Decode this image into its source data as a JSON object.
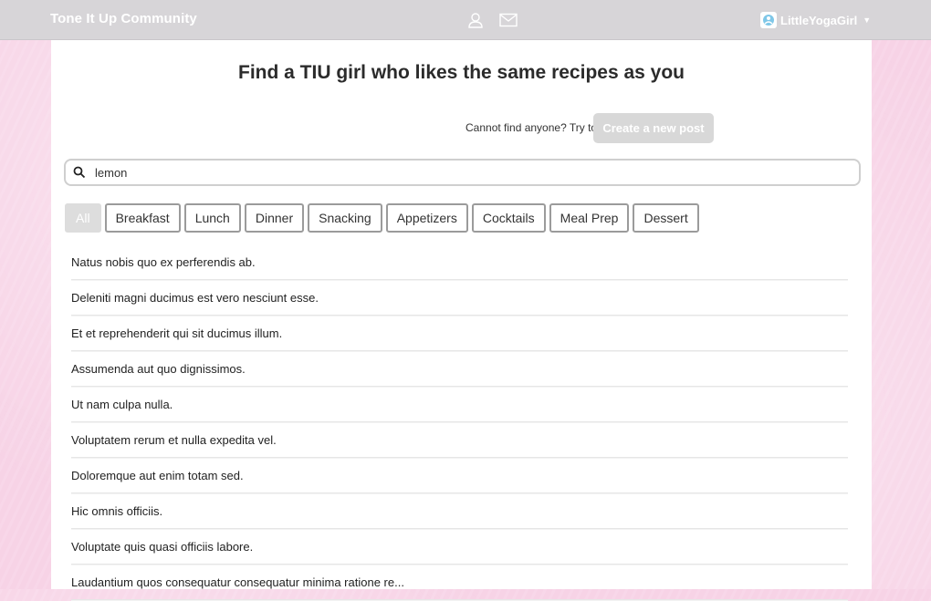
{
  "topbar": {
    "brand": "Tone It Up Community",
    "icons": [
      "user-icon",
      "mail-icon"
    ],
    "user_name": "LittleYogaGirl"
  },
  "main": {
    "title": "Find a TIU girl who likes the same recipes as you",
    "helper_text": "Cannot find anyone? Try to:",
    "create_post_label": "Create a new post",
    "search": {
      "value": "lemon"
    },
    "filters": [
      "All",
      "Breakfast",
      "Lunch",
      "Dinner",
      "Snacking",
      "Appetizers",
      "Cocktails",
      "Meal Prep",
      "Dessert"
    ],
    "active_filter": "All",
    "results": [
      "Natus nobis quo ex perferendis ab.",
      "Deleniti magni ducimus est vero nesciunt esse.",
      "Et et reprehenderit qui sit ducimus illum.",
      "Assumenda aut quo dignissimos.",
      "Ut nam culpa nulla.",
      "Voluptatem rerum et nulla expedita vel.",
      "Doloremque aut enim totam sed.",
      "Hic omnis officiis.",
      "Voluptate quis quasi officiis labore.",
      "Laudantium quos consequatur consequatur minima ratione re..."
    ]
  },
  "colors": {
    "page_background": "#f7d3e6",
    "topbar": "#d7d5d8",
    "button_disabled": "#d8d8d8",
    "chip_border": "#9b9b9b"
  }
}
